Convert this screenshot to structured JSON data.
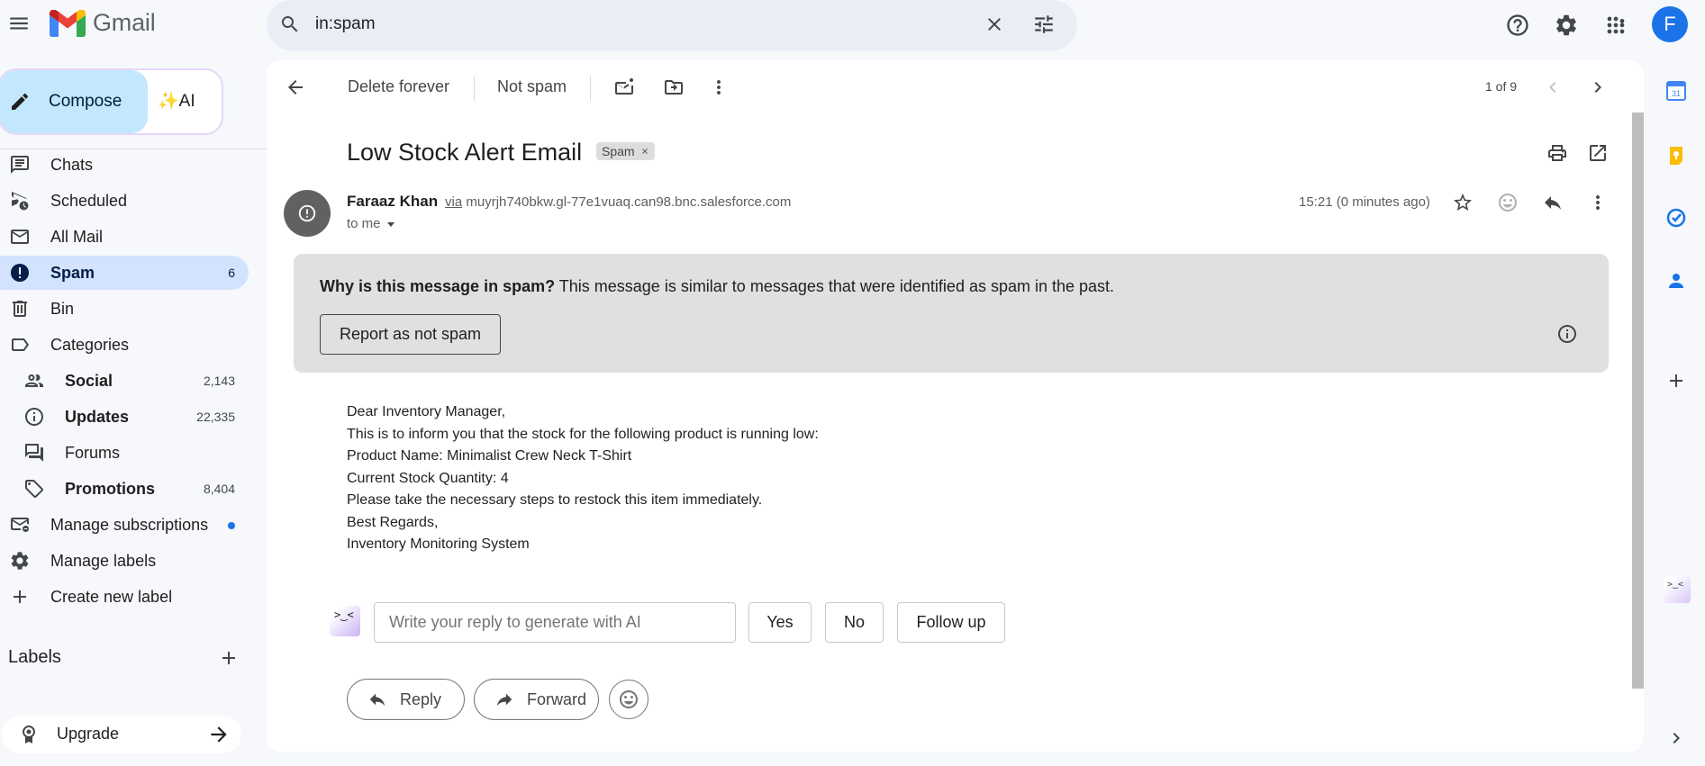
{
  "app": {
    "name": "Gmail"
  },
  "search": {
    "query": "in:spam"
  },
  "account": {
    "initial": "F"
  },
  "compose": {
    "label": "Compose",
    "ai_label": "✨AI"
  },
  "sidebar": {
    "items": [
      {
        "label": "Chats",
        "count": ""
      },
      {
        "label": "Scheduled",
        "count": ""
      },
      {
        "label": "All Mail",
        "count": ""
      },
      {
        "label": "Spam",
        "count": "6"
      },
      {
        "label": "Bin",
        "count": ""
      },
      {
        "label": "Categories",
        "count": ""
      },
      {
        "label": "Social",
        "count": "2,143"
      },
      {
        "label": "Updates",
        "count": "22,335"
      },
      {
        "label": "Forums",
        "count": ""
      },
      {
        "label": "Promotions",
        "count": "8,404"
      },
      {
        "label": "Manage subscriptions",
        "count": ""
      },
      {
        "label": "Manage labels",
        "count": ""
      },
      {
        "label": "Create new label",
        "count": ""
      }
    ],
    "labels_title": "Labels",
    "upgrade_label": "Upgrade"
  },
  "toolbar": {
    "delete_forever": "Delete forever",
    "not_spam": "Not spam",
    "pager": "1 of 9"
  },
  "message": {
    "subject": "Low Stock Alert Email",
    "chip": "Spam",
    "sender_name": "Faraaz Khan",
    "via_word": "via",
    "via_domain": "muyrjh740bkw.gl-77e1vuaq.can98.bnc.salesforce.com",
    "to": "to me",
    "time": "15:21 (0 minutes ago)",
    "body": [
      "Dear Inventory Manager,",
      "This is to inform you that the stock for the following product is running low:",
      "Product Name: Minimalist Crew Neck T-Shirt",
      "Current Stock Quantity: 4",
      "Please take the necessary steps to restock this item immediately.",
      "Best Regards,",
      "Inventory Monitoring System"
    ]
  },
  "spam_banner": {
    "question": "Why is this message in spam?",
    "explanation": " This message is similar to messages that were identified as spam in the past.",
    "report_button": "Report as not spam"
  },
  "ai_reply": {
    "placeholder": "Write your reply to generate with AI",
    "suggestions": [
      "Yes",
      "No",
      "Follow up"
    ],
    "logo_glyph": ">‿<"
  },
  "actions": {
    "reply": "Reply",
    "forward": "Forward"
  },
  "colors": {
    "accent": "#1a73e8",
    "compose_bg": "#c2e7ff",
    "active_nav_bg": "#d3e3fd",
    "banner_bg": "#e0e0e0"
  }
}
